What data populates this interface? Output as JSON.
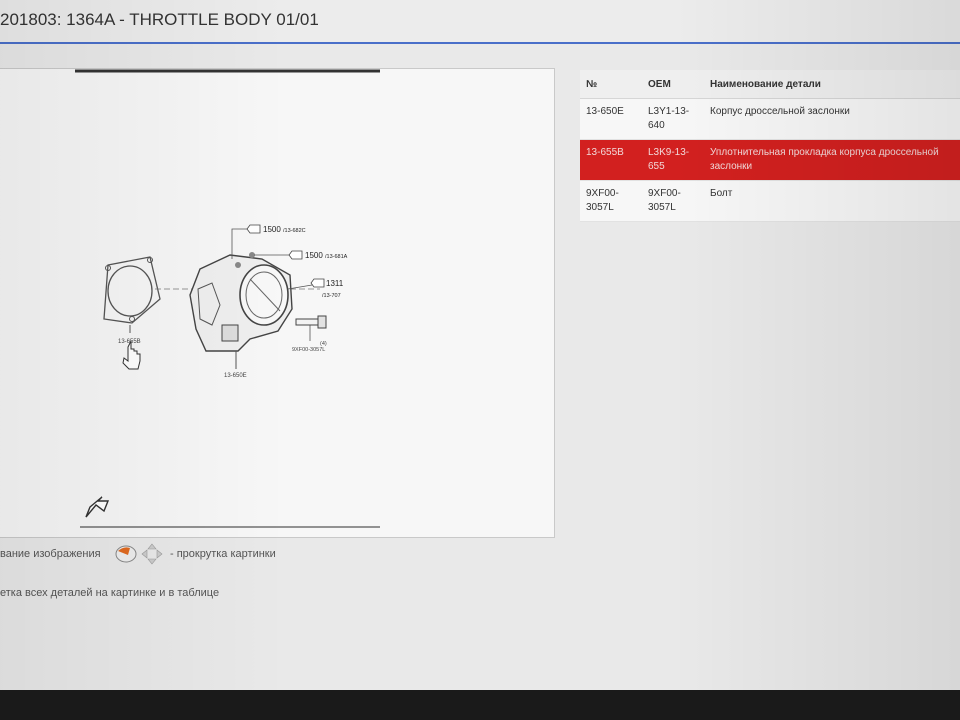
{
  "window": {
    "title": "201803: 1364A - THROTTLE BODY 01/01"
  },
  "diagram": {
    "callouts": {
      "ref_682c": "1500",
      "ref_682c_sub": "/13-682C",
      "ref_681a": "1500",
      "ref_681a_sub": "/13-681A",
      "ref_707": "1311",
      "ref_707_sub": "/13-707",
      "gasket_label": "13-655B",
      "bolt_label": "9XF00-3057L",
      "bolt_qty": "(4)",
      "body_label": "13-650E"
    }
  },
  "hints": {
    "zoom_hint": "вание изображения",
    "scroll_hint": "- прокрутка картинки",
    "select_hint": "етка всех деталей на картинке и в таблице"
  },
  "parts_table": {
    "headers": {
      "no": "№",
      "oem": "OEM",
      "name": "Наименование детали"
    },
    "rows": [
      {
        "no": "13-650E",
        "oem": "L3Y1-13-640",
        "name": "Корпус дроссельной заслонки",
        "selected": false
      },
      {
        "no": "13-655B",
        "oem": "L3K9-13-655",
        "name": "Уплотнительная прокладка корпуса дроссельной заслонки",
        "selected": true
      },
      {
        "no": "9XF00-3057L",
        "oem": "9XF00-3057L",
        "name": "Болт",
        "selected": false
      }
    ]
  },
  "colors": {
    "accent": "#4a6fc9",
    "selected_row": "#d2201f"
  }
}
